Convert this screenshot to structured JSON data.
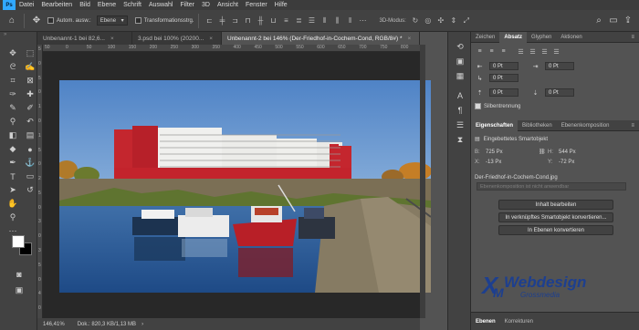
{
  "menu": [
    "Datei",
    "Bearbeiten",
    "Bild",
    "Ebene",
    "Schrift",
    "Auswahl",
    "Filter",
    "3D",
    "Ansicht",
    "Fenster",
    "Hilfe"
  ],
  "options": {
    "auto_select_label": "Autom. ausw.:",
    "auto_select_value": "Ebene",
    "transform_label": "Transformationsstrg.",
    "mode_3d_label": "3D-Modus:"
  },
  "tabs": [
    {
      "label": "Unbenannt-1 bei 82,6...",
      "active": false
    },
    {
      "label": "3.psd bei 100% (20200...",
      "active": false
    },
    {
      "label": "Unbenannt-2 bei 146% (Der-Friedhof-in-Cochem-Cond, RGB/8#) *",
      "active": true
    }
  ],
  "ruler": {
    "top_ticks": [
      "50",
      "0",
      "50",
      "100",
      "150",
      "200",
      "250",
      "300",
      "350",
      "400",
      "450",
      "500",
      "550",
      "600",
      "650",
      "700",
      "750",
      "800"
    ],
    "left_ticks": [
      "5",
      "0",
      "5",
      "0",
      "1",
      "0",
      "1",
      "5",
      "0",
      "2",
      "5",
      "0",
      "3",
      "0",
      "3",
      "5",
      "0",
      "4",
      "0"
    ]
  },
  "status": {
    "zoom": "146,41%",
    "doc": "Dok.: 820,3 KB/1,13 MB"
  },
  "char_panel": {
    "tabs": [
      "Zeichen",
      "Absatz",
      "Glyphen",
      "Aktionen"
    ],
    "active_tab": "Absatz",
    "indent_fields": [
      {
        "left": "0 Pt",
        "right": "0 Pt"
      },
      {
        "left": "0 Pt"
      },
      {
        "left": "0 Pt",
        "right": "0 Pt"
      }
    ],
    "hyphenation_label": "Silbentrennung"
  },
  "props_panel": {
    "tabs": [
      "Eigenschaften",
      "Bibliotheken",
      "Ebenenkomposition"
    ],
    "active_tab": "Eigenschaften",
    "type_label": "Eingebettetes Smartobjekt",
    "w": "725 Px",
    "h": "544 Px",
    "x": "-13 Px",
    "y": "-72 Px",
    "filename": "Der-Friedhof-in-Cochem-Cond.jpg",
    "comp_placeholder": "Ebenenkomposition ist nicht anwendbar",
    "buttons": [
      "Inhalt bearbeiten",
      "In verknüpftes Smartobjekt konvertieren...",
      "In Ebenen konvertieren"
    ]
  },
  "layers_panel": {
    "tabs": [
      "Ebenen",
      "Korrekturen"
    ]
  },
  "watermark": {
    "line1": "Webdesign",
    "line2": "Grossmedia"
  },
  "colors": {
    "accent": "#31a8ff",
    "foreground": "#ffffff",
    "background": "#000000"
  }
}
